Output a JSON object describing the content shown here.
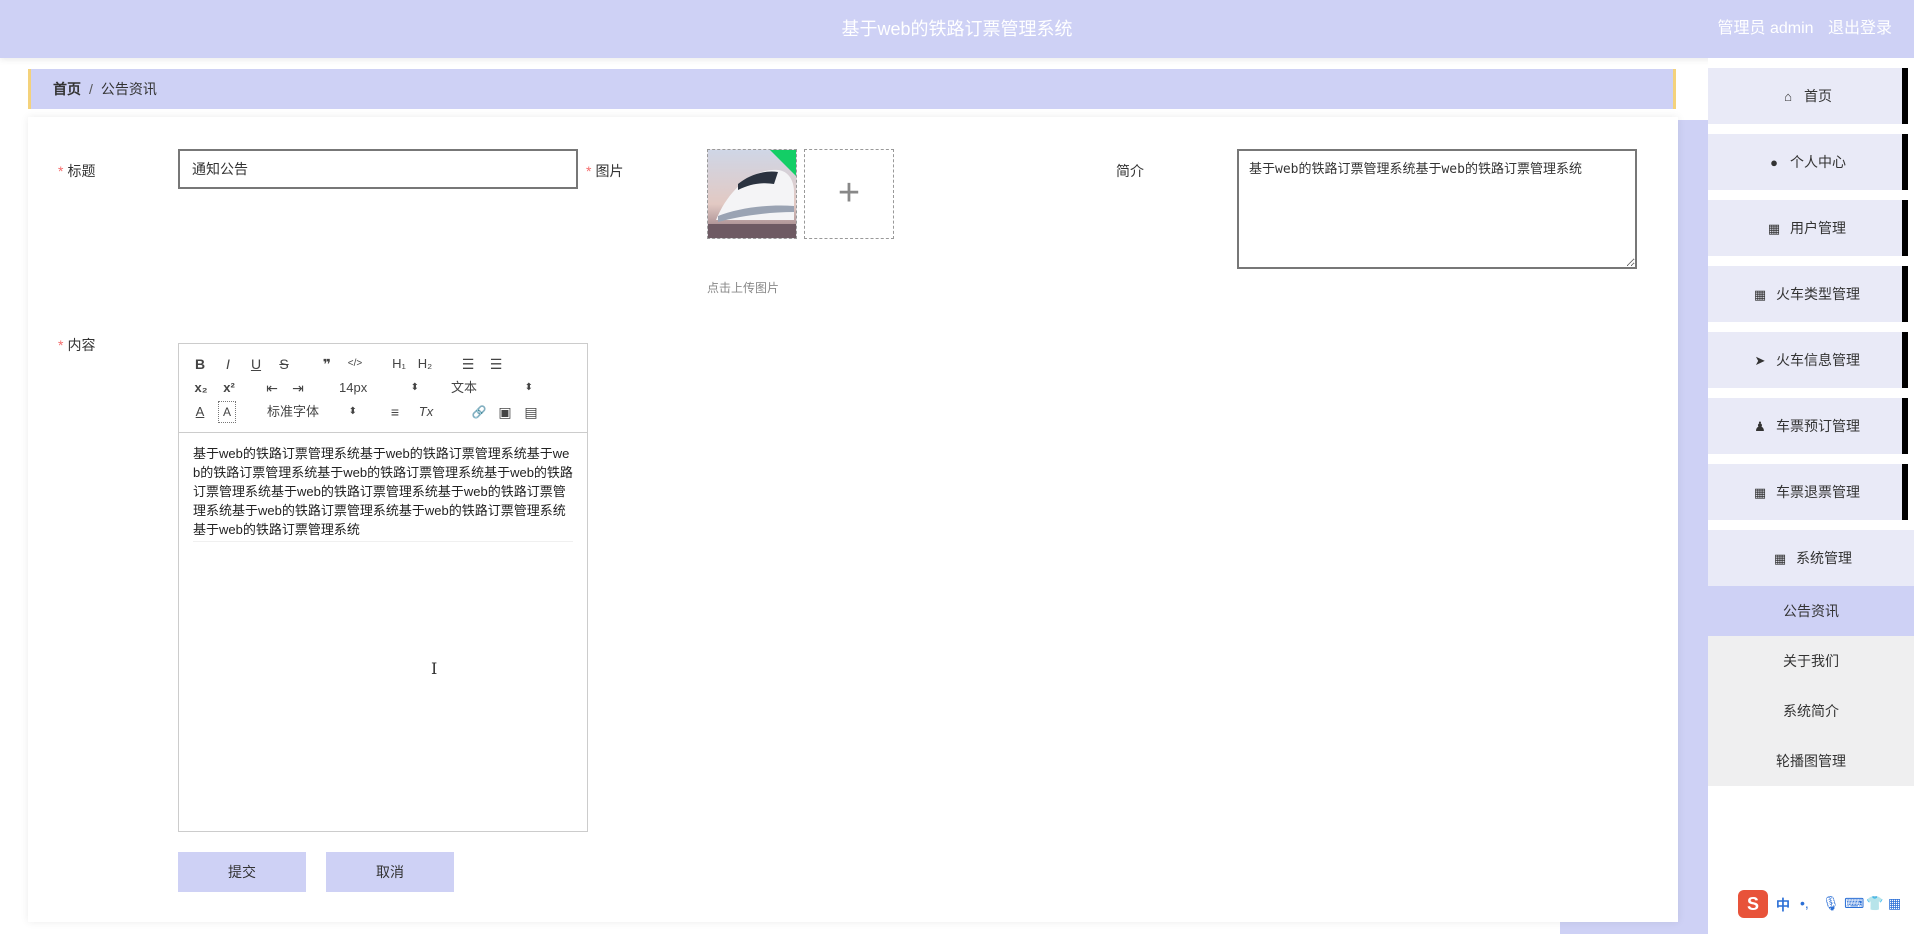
{
  "header": {
    "title": "基于web的铁路订票管理系统",
    "user_label": "管理员 admin",
    "logout_label": "退出登录"
  },
  "breadcrumb": {
    "home": "首页",
    "separator": "/",
    "current": "公告资讯"
  },
  "form": {
    "title_label": "标题",
    "title_value": "通知公告",
    "image_label": "图片",
    "image_upload_tip": "点击上传图片",
    "upload_plus": "+",
    "intro_label": "简介",
    "intro_value": "基于web的铁路订票管理系统基于web的铁路订票管理系统",
    "content_label": "内容",
    "required_mark": "*",
    "editor": {
      "font_size": "14px",
      "heading": "文本",
      "font_family": "标准字体",
      "content": "基于web的铁路订票管理系统基于web的铁路订票管理系统基于web的铁路订票管理系统基于web的铁路订票管理系统基于web的铁路订票管理系统基于web的铁路订票管理系统基于web的铁路订票管理系统基于web的铁路订票管理系统基于web的铁路订票管理系统基于web的铁路订票管理系统",
      "tools": {
        "bold": "B",
        "italic": "I",
        "underline": "U",
        "strike": "S",
        "quote": "❞",
        "code": "</>",
        "h1": "H₁",
        "h2": "H₂",
        "ordered_list": "☰",
        "bullet_list": "☰",
        "sub": "x₂",
        "sup": "x²",
        "outdent": "⇤",
        "indent": "⇥",
        "color": "A",
        "background": "A",
        "align": "≡",
        "clean": "Tx",
        "link": "🔗",
        "image": "▣",
        "video": "▤"
      }
    },
    "submit_label": "提交",
    "cancel_label": "取消"
  },
  "sidebar": {
    "items": [
      {
        "label": "首页",
        "icon": "home-icon",
        "glyph": "⌂"
      },
      {
        "label": "个人中心",
        "icon": "user-icon",
        "glyph": "●"
      },
      {
        "label": "用户管理",
        "icon": "grid-icon",
        "glyph": "▦"
      },
      {
        "label": "火车类型管理",
        "icon": "grid-icon",
        "glyph": "▦"
      },
      {
        "label": "火车信息管理",
        "icon": "send-icon",
        "glyph": "➤"
      },
      {
        "label": "车票预订管理",
        "icon": "stamp-icon",
        "glyph": "♟"
      },
      {
        "label": "车票退票管理",
        "icon": "grid-icon",
        "glyph": "▦"
      },
      {
        "label": "系统管理",
        "icon": "grid-icon",
        "glyph": "▦"
      }
    ],
    "submenu": [
      {
        "label": "公告资讯",
        "active": true
      },
      {
        "label": "关于我们",
        "active": false
      },
      {
        "label": "系统简介",
        "active": false
      },
      {
        "label": "轮播图管理",
        "active": false
      }
    ]
  },
  "ime": {
    "logo": "S",
    "mode": "中"
  },
  "colors": {
    "accent": "#ced1f5",
    "breadcrumb_border": "#f4d27b",
    "required": "#f56c6c"
  }
}
